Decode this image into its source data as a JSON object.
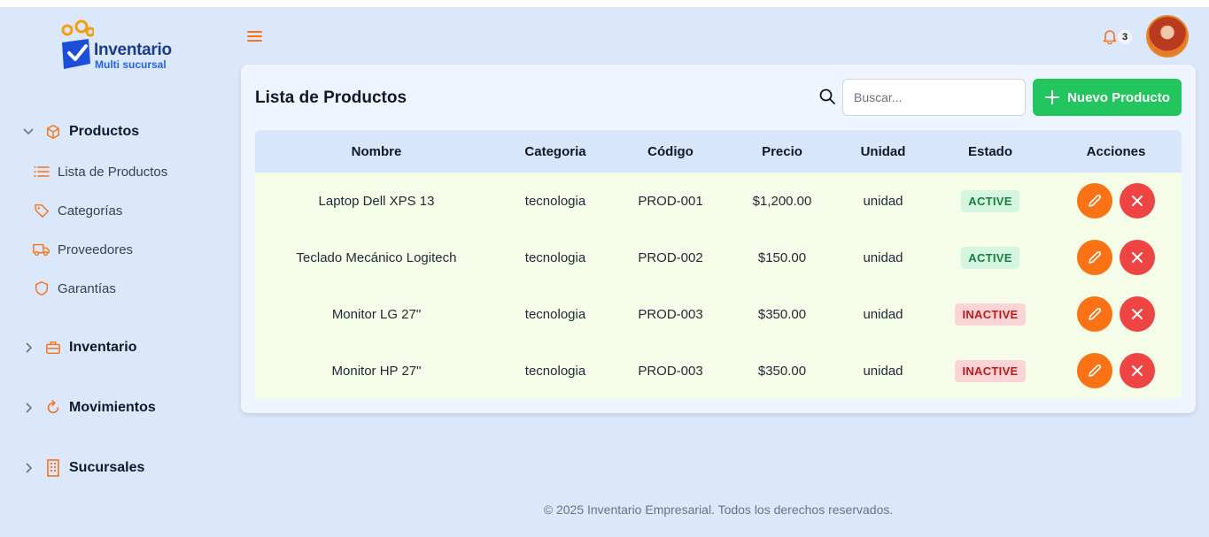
{
  "brand": {
    "title": "Inventario",
    "subtitle": "Multi sucursal"
  },
  "sidebar": {
    "groups": [
      {
        "label": "Productos",
        "icon": "cube-icon",
        "expanded": true,
        "items": [
          {
            "label": "Lista de Productos",
            "icon": "list-icon"
          },
          {
            "label": "Categorías",
            "icon": "tag-icon"
          },
          {
            "label": "Proveedores",
            "icon": "truck-icon"
          },
          {
            "label": "Garantías",
            "icon": "shield-icon"
          }
        ]
      },
      {
        "label": "Inventario",
        "icon": "briefcase-icon",
        "expanded": false
      },
      {
        "label": "Movimientos",
        "icon": "refresh-icon",
        "expanded": false
      },
      {
        "label": "Sucursales",
        "icon": "building-icon",
        "expanded": false
      }
    ]
  },
  "topbar": {
    "notifications": "3"
  },
  "main": {
    "title": "Lista de Productos",
    "search": {
      "placeholder": "Buscar...",
      "value": ""
    },
    "new_button": "Nuevo Producto",
    "table": {
      "headers": [
        "Nombre",
        "Categoria",
        "Código",
        "Precio",
        "Unidad",
        "Estado",
        "Acciones"
      ],
      "rows": [
        {
          "nombre": "Laptop Dell XPS 13",
          "categoria": "tecnologia",
          "codigo": "PROD-001",
          "precio": "$1,200.00",
          "unidad": "unidad",
          "estado": "ACTIVE"
        },
        {
          "nombre": "Teclado Mecánico Logitech",
          "categoria": "tecnologia",
          "codigo": "PROD-002",
          "precio": "$150.00",
          "unidad": "unidad",
          "estado": "ACTIVE"
        },
        {
          "nombre": "Monitor LG 27\"",
          "categoria": "tecnologia",
          "codigo": "PROD-003",
          "precio": "$350.00",
          "unidad": "unidad",
          "estado": "INACTIVE"
        },
        {
          "nombre": "Monitor HP 27\"",
          "categoria": "tecnologia",
          "codigo": "PROD-003",
          "precio": "$350.00",
          "unidad": "unidad",
          "estado": "INACTIVE"
        }
      ]
    }
  },
  "footer": "© 2025 Inventario Empresarial. Todos los derechos reservados.",
  "colors": {
    "accent": "#f97316",
    "success": "#22c55e",
    "danger": "#ef4444",
    "background": "#dbe8fb"
  }
}
